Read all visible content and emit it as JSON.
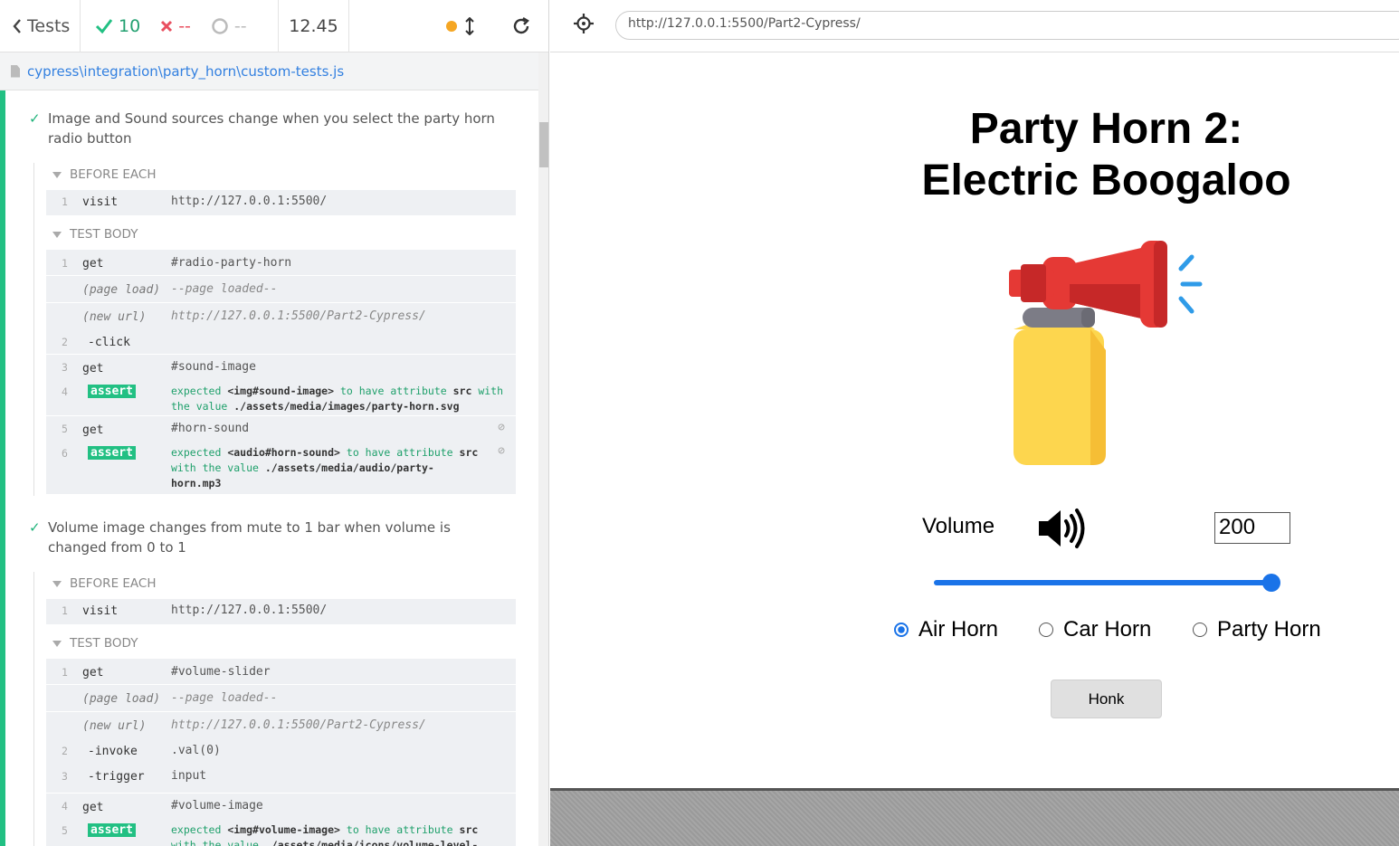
{
  "topbar": {
    "tests_label": "Tests",
    "passed": "10",
    "failed": "--",
    "pending": "--",
    "duration": "12.45"
  },
  "spec": {
    "path": "cypress\\integration\\party_horn\\custom-tests.js"
  },
  "tests": [
    {
      "title": "Image and Sound sources change when you select the party horn radio button",
      "before_each_label": "BEFORE EACH",
      "before_each": [
        {
          "num": "1",
          "name": "visit",
          "msg": "http://127.0.0.1:5500/"
        }
      ],
      "body_label": "TEST BODY",
      "body": [
        {
          "num": "1",
          "name": "get",
          "msg": "#radio-party-horn"
        },
        {
          "name": "(page load)",
          "msg": "--page loaded--"
        },
        {
          "name": "(new url)",
          "msg": "http://127.0.0.1:5500/Part2-Cypress/"
        },
        {
          "num": "2",
          "name": "-click",
          "msg": ""
        },
        {
          "num": "3",
          "name": "get",
          "msg": "#sound-image"
        },
        {
          "num": "4",
          "name": "assert",
          "a1": "expected",
          "a2": "<img#sound-image>",
          "a3": "to have attribute",
          "a4": "src",
          "a5": "with the value",
          "a6": "./assets/media/images/party-horn.svg"
        },
        {
          "num": "5",
          "name": "get",
          "msg": "#horn-sound"
        },
        {
          "num": "6",
          "name": "assert",
          "a1": "expected",
          "a2": "<audio#horn-sound>",
          "a3": "to have attribute",
          "a4": "src",
          "a5": "with the value",
          "a6": "./assets/media/audio/party-horn.mp3"
        }
      ]
    },
    {
      "title": "Volume image changes from mute to 1 bar when volume is changed from 0 to 1",
      "before_each_label": "BEFORE EACH",
      "before_each": [
        {
          "num": "1",
          "name": "visit",
          "msg": "http://127.0.0.1:5500/"
        }
      ],
      "body_label": "TEST BODY",
      "body": [
        {
          "num": "1",
          "name": "get",
          "msg": "#volume-slider"
        },
        {
          "name": "(page load)",
          "msg": "--page loaded--"
        },
        {
          "name": "(new url)",
          "msg": "http://127.0.0.1:5500/Part2-Cypress/"
        },
        {
          "num": "2",
          "name": "-invoke",
          "msg": ".val(0)"
        },
        {
          "num": "3",
          "name": "-trigger",
          "msg": "input"
        },
        {
          "num": "4",
          "name": "get",
          "msg": "#volume-image"
        },
        {
          "num": "5",
          "name": "assert",
          "a1": "expected",
          "a2": "<img#volume-image>",
          "a3": "to have attribute",
          "a4": "src",
          "a5": "with the value",
          "a6": "./assets/media/icons/volume-level-"
        }
      ]
    }
  ],
  "aut": {
    "url": "http://127.0.0.1:5500/Part2-Cypress/",
    "title_line1": "Party Horn 2:",
    "title_line2": "Electric Boogaloo",
    "volume_label": "Volume",
    "volume_value": "200",
    "volume_slider_fraction": 1.0,
    "radios": [
      {
        "label": "Air Horn",
        "checked": true
      },
      {
        "label": "Car Horn",
        "checked": false
      },
      {
        "label": "Party Horn",
        "checked": false
      }
    ],
    "honk_label": "Honk"
  },
  "colors": {
    "pass": "#22c083",
    "fail": "#e94f5f",
    "accent": "#1a73e8"
  }
}
